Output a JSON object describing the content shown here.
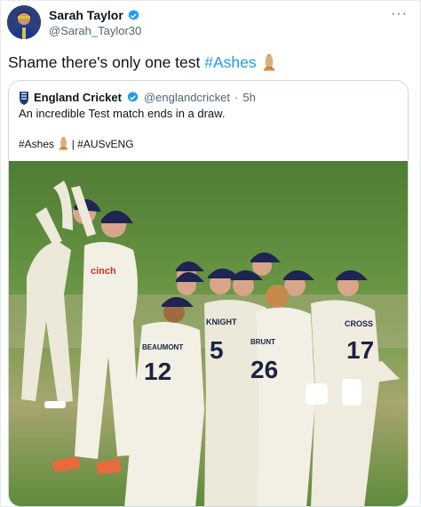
{
  "tweet": {
    "author_name": "Sarah Taylor",
    "author_handle": "@Sarah_Taylor30",
    "text_prefix": "Shame there's only one test ",
    "hashtag": "#Ashes",
    "more_label": "···"
  },
  "quoted": {
    "author_name": "England Cricket",
    "author_handle": "@englandcricket",
    "time": "5h",
    "text": "An incredible Test match ends in a draw.",
    "tag1": "#Ashes",
    "separator": "| ",
    "tag2": "#AUSvENG",
    "photo": {
      "jersey_numbers": [
        "12",
        "5",
        "26",
        "17"
      ],
      "jersey_names": [
        "BEAUMONT",
        "KNIGHT",
        "BRUNT",
        "CROSS"
      ],
      "sponsor": "cinch"
    }
  },
  "colors": {
    "link": "#1d9bf0",
    "verified": "#1d9bf0",
    "grass": "#6d9a4a",
    "kit": "#f2efe4",
    "cap": "#1d2550"
  },
  "icons": {
    "verified": "verified-badge-icon",
    "trophy": "ashes-urn-icon",
    "more": "more-options-icon"
  }
}
